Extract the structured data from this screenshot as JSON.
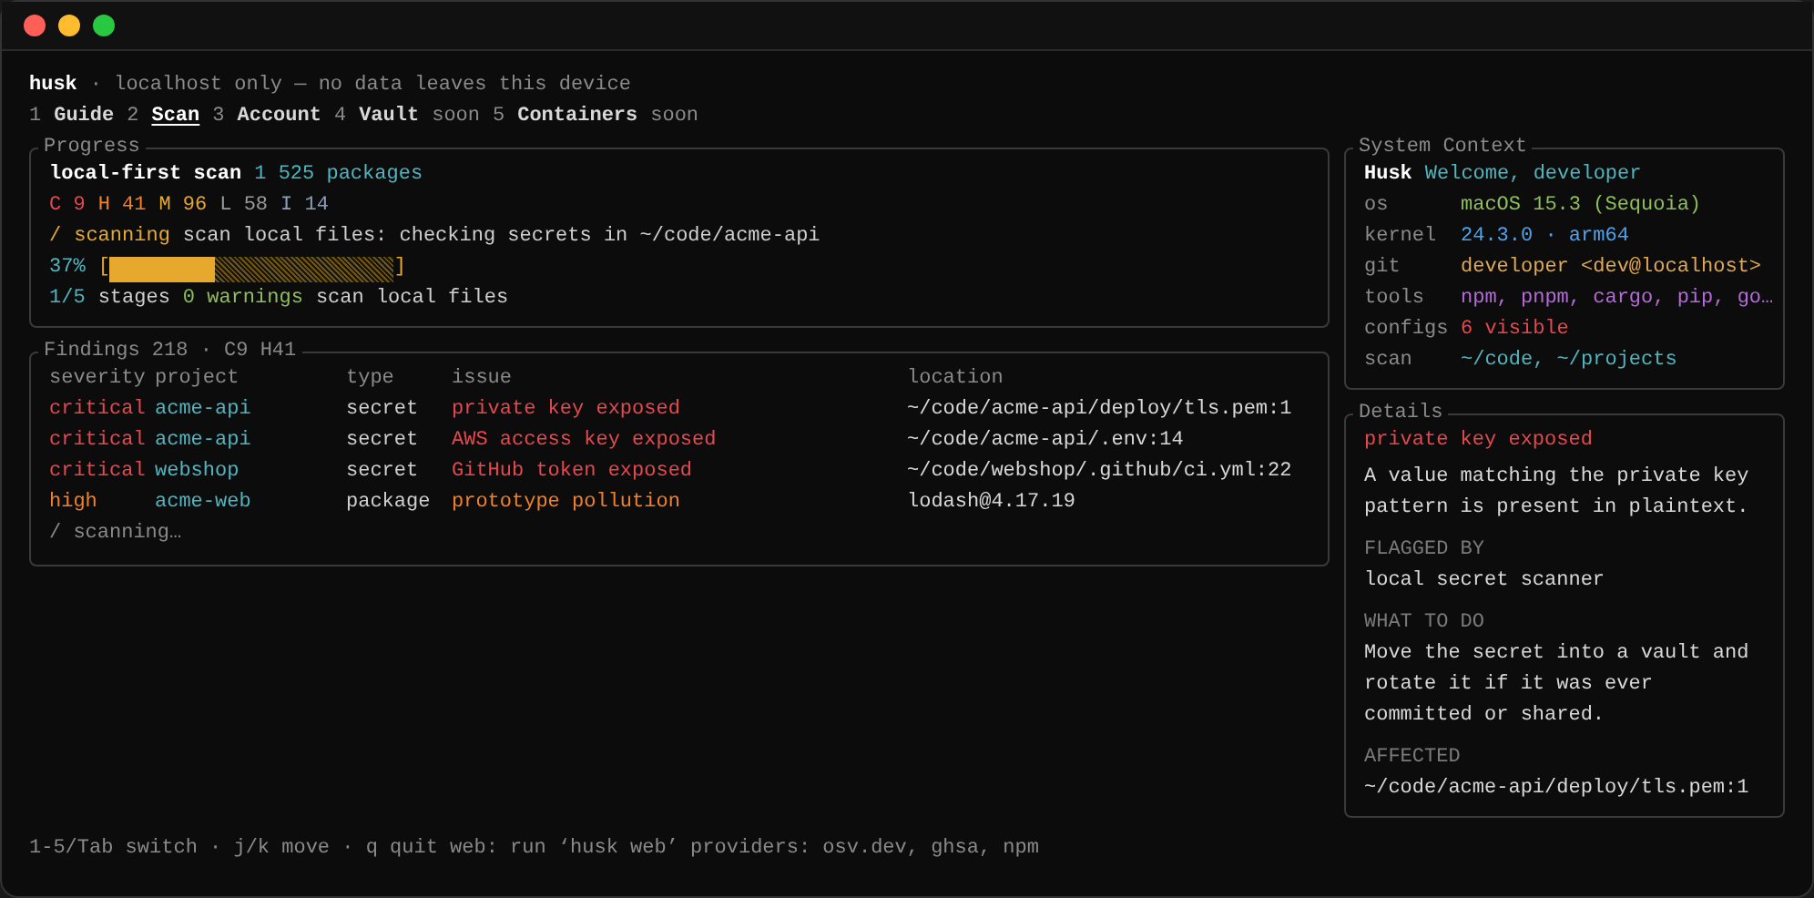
{
  "header": {
    "app": "husk",
    "tagline": "· localhost only — no data leaves this device"
  },
  "tabs": [
    {
      "number": "1",
      "label": "Guide",
      "selected": false
    },
    {
      "number": "2",
      "label": "Scan",
      "selected": true
    },
    {
      "number": "3",
      "label": "Account",
      "selected": false
    },
    {
      "number": "4",
      "label": "Vault",
      "selected": false,
      "badge": "soon"
    },
    {
      "number": "5",
      "label": "Containers",
      "selected": false,
      "badge": "soon"
    }
  ],
  "progress": {
    "title": "Progress",
    "heading": "local-first scan",
    "count": "1 525 packages",
    "severity_counts": [
      {
        "letter": "C",
        "count": "9",
        "color": "#e5484d"
      },
      {
        "letter": "H",
        "count": "41",
        "color": "#f0802a"
      },
      {
        "letter": "M",
        "count": "96",
        "color": "#e6a92e"
      },
      {
        "letter": "L",
        "count": "58",
        "color": "#9a9a9a"
      },
      {
        "letter": "I",
        "count": "14",
        "color": "#8aa0b8"
      }
    ],
    "spinner": "/",
    "status": "scanning",
    "activity": "scan local files: checking secrets in ~/code/acme-api",
    "percent": "37%",
    "bar_open": "[",
    "bar_close": "]",
    "level": 0.37,
    "stages": "1/5",
    "stages_label": "stages",
    "warnings": "0 warnings",
    "stage_name": "scan local files"
  },
  "findings": {
    "title": "Findings 218 · C9 H41",
    "columns": [
      "severity",
      "project",
      "type",
      "issue",
      "location"
    ],
    "rows": [
      {
        "severity": "critical",
        "project": "acme-api",
        "type": "secret",
        "issue": "private key exposed",
        "location": "~/code/acme-api/deploy/tls.pem:1",
        "color": "#e5484d"
      },
      {
        "severity": "critical",
        "project": "acme-api",
        "type": "secret",
        "issue": "AWS access key exposed",
        "location": "~/code/acme-api/.env:14",
        "color": "#e5484d"
      },
      {
        "severity": "critical",
        "project": "webshop",
        "type": "secret",
        "issue": "GitHub token exposed",
        "location": "~/code/webshop/.github/ci.yml:22",
        "color": "#e5484d"
      },
      {
        "severity": "high",
        "project": "acme-web",
        "type": "package",
        "issue": "prototype pollution",
        "location": "lodash@4.17.19",
        "color": "#f0802a"
      }
    ],
    "footer": "/ scanning…"
  },
  "system_context": {
    "title": "System Context",
    "name": "Husk",
    "greeting": "Welcome, developer",
    "rows": [
      {
        "key": "os",
        "value": "macOS 15.3 (Sequoia)",
        "color": "#8fbf5a"
      },
      {
        "key": "kernel",
        "value": "24.3.0 · arm64",
        "color": "#4ea3ec"
      },
      {
        "key": "git",
        "value": "developer <dev@localhost>",
        "color": "#e0a852"
      },
      {
        "key": "tools",
        "value": "npm, pnpm, cargo, pip, go…",
        "color": "#b46ad8"
      },
      {
        "key": "configs",
        "value": "6 visible",
        "color": "#e5484d"
      },
      {
        "key": "scan",
        "value": "~/code, ~/projects",
        "color": "#4fb6bf"
      }
    ]
  },
  "details": {
    "title": "Details",
    "issue": "private key exposed",
    "description": "A value matching the private key pattern is present in plaintext.",
    "sections": [
      {
        "heading": "FLAGGED BY",
        "body": "local secret scanner"
      },
      {
        "heading": "WHAT TO DO",
        "body": "Move the secret into a vault and rotate it if it was ever committed or shared."
      },
      {
        "heading": "AFFECTED",
        "body": "~/code/acme-api/deploy/tls.pem:1"
      }
    ]
  },
  "status_bar": "1-5/Tab switch · j/k move · q quit web: run ‘husk web’ providers: osv.dev, ghsa, npm"
}
